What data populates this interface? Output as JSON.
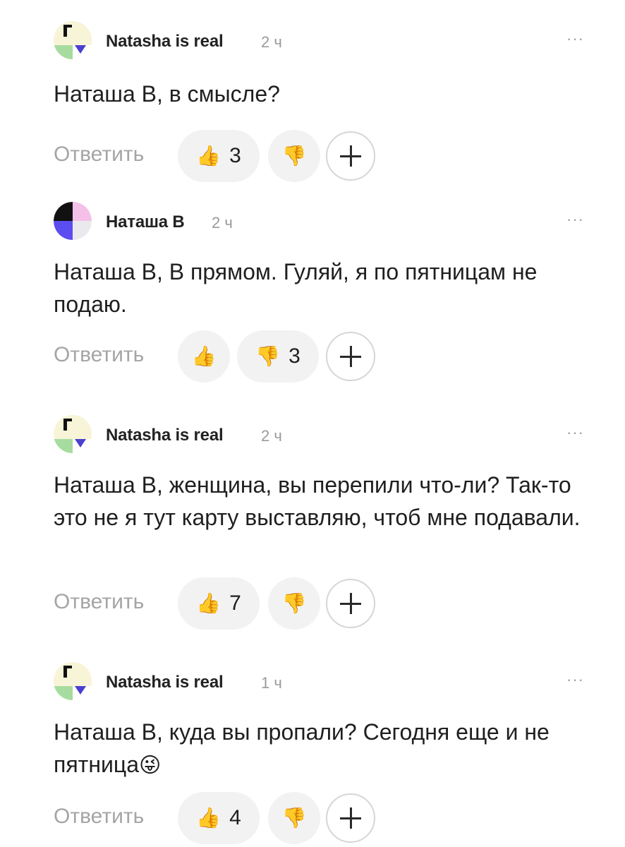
{
  "colors": {
    "reply": "#a5a5a5",
    "time": "#9a9a9a",
    "pill_bg": "#f2f2f2"
  },
  "icons": {
    "like": "thumbs-up-icon",
    "dislike": "thumbs-down-icon",
    "add": "plus-icon",
    "more": "more-dots-icon"
  },
  "reply_label": "Ответить",
  "more_label": "···",
  "comments": [
    {
      "author": "Natasha is real",
      "time": "2 ч",
      "text": "Наташа В, в смысле?",
      "likes": "3",
      "dislikes": ""
    },
    {
      "author": "Наташа В",
      "time": "2 ч",
      "text": "Наташа В, В прямом. Гуляй, я по пятницам не подаю.",
      "likes": "",
      "dislikes": "3"
    },
    {
      "author": "Natasha is real",
      "time": "2 ч",
      "text": "Наташа В, женщина, вы перепили что-ли? Так-то это не я тут карту выставляю, чтоб мне подавали.",
      "likes": "7",
      "dislikes": ""
    },
    {
      "author": "Natasha is real",
      "time": "1 ч",
      "text": "Наташа В, куда вы пропали? Сегодня еще и не пятница",
      "likes": "4",
      "dislikes": ""
    }
  ]
}
